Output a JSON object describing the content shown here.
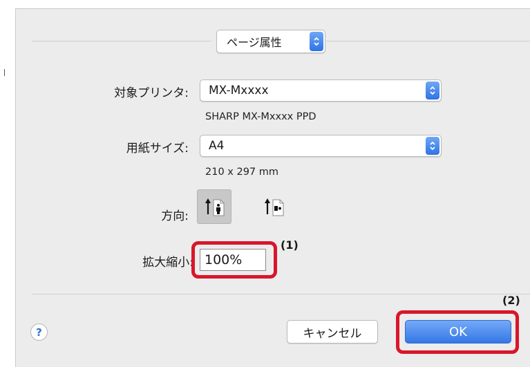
{
  "page_attributes_popup": {
    "label": "ページ属性"
  },
  "form": {
    "printer_label": "対象プリンタ:",
    "printer_value": "MX-Mxxxx",
    "printer_detail": "SHARP MX-Mxxxx PPD",
    "paper_label": "用紙サイズ:",
    "paper_value": "A4",
    "paper_detail": "210 x 297 mm",
    "orientation_label": "方向:",
    "orientation_selected": "portrait",
    "scale_label": "拡大縮小:",
    "scale_value": "100%"
  },
  "buttons": {
    "help": "?",
    "cancel": "キャンセル",
    "ok": "OK"
  },
  "callouts": [
    "(1)",
    "(2)"
  ],
  "colors": {
    "accent_blue": "#3478e6",
    "callout_red": "#d8162b",
    "dialog_bg": "#ececec"
  }
}
